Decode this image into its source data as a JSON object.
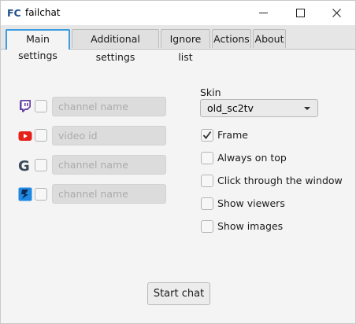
{
  "window": {
    "title": "failchat",
    "logo_text": "FC"
  },
  "tabs": [
    {
      "label": "Main settings",
      "active": true
    },
    {
      "label": "Additional settings",
      "active": false
    },
    {
      "label": "Ignore list",
      "active": false
    },
    {
      "label": "Actions",
      "active": false
    },
    {
      "label": "About",
      "active": false
    }
  ],
  "sources": [
    {
      "icon": "twitch-icon",
      "placeholder": "channel name",
      "checked": false
    },
    {
      "icon": "youtube-icon",
      "placeholder": "video id",
      "checked": false
    },
    {
      "icon": "goodgame-icon",
      "placeholder": "channel name",
      "checked": false
    },
    {
      "icon": "peka2tv-icon",
      "placeholder": "channel name",
      "checked": false
    }
  ],
  "skin": {
    "label": "Skin",
    "selected": "old_sc2tv"
  },
  "options": [
    {
      "label": "Frame",
      "checked": true
    },
    {
      "label": "Always on top",
      "checked": false
    },
    {
      "label": "Click through the window",
      "checked": false
    },
    {
      "label": "Show viewers",
      "checked": false
    },
    {
      "label": "Show images",
      "checked": false
    }
  ],
  "start_button": {
    "label": "Start chat"
  },
  "colors": {
    "accent": "#3c9ce0",
    "twitch": "#6441a5",
    "youtube": "#e62117",
    "goodgame": "#39485a",
    "peka2tv": "#1e88e5"
  }
}
